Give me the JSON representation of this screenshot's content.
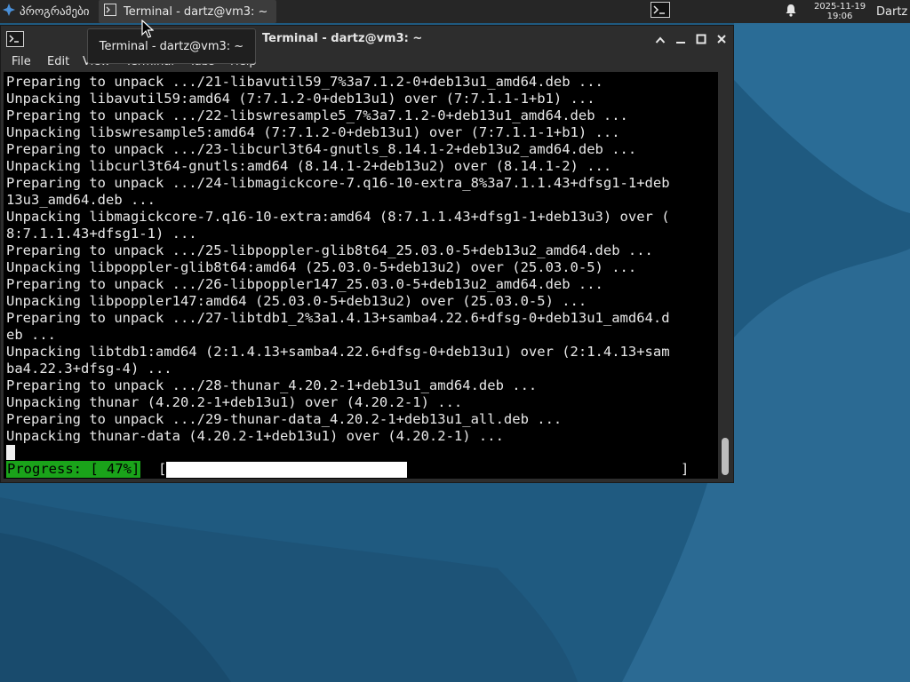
{
  "panel": {
    "app_menu_label": "პროგრამები",
    "task_title": "Terminal - dartz@vm3: ~",
    "clock_date": "2025-11-19",
    "clock_time": "19:06",
    "user_name": "Dartz"
  },
  "tooltip": {
    "text": "Terminal - dartz@vm3: ~"
  },
  "window": {
    "title": "Terminal - dartz@vm3: ~",
    "menu": [
      "File",
      "Edit",
      "View",
      "Terminal",
      "Tabs",
      "Help"
    ]
  },
  "terminal": {
    "lines": [
      "Preparing to unpack .../21-libavutil59_7%3a7.1.2-0+deb13u1_amd64.deb ...",
      "Unpacking libavutil59:amd64 (7:7.1.2-0+deb13u1) over (7:7.1.1-1+b1) ...",
      "Preparing to unpack .../22-libswresample5_7%3a7.1.2-0+deb13u1_amd64.deb ...",
      "Unpacking libswresample5:amd64 (7:7.1.2-0+deb13u1) over (7:7.1.1-1+b1) ...",
      "Preparing to unpack .../23-libcurl3t64-gnutls_8.14.1-2+deb13u2_amd64.deb ...",
      "Unpacking libcurl3t64-gnutls:amd64 (8.14.1-2+deb13u2) over (8.14.1-2) ...",
      "Preparing to unpack .../24-libmagickcore-7.q16-10-extra_8%3a7.1.1.43+dfsg1-1+deb",
      "13u3_amd64.deb ...",
      "Unpacking libmagickcore-7.q16-10-extra:amd64 (8:7.1.1.43+dfsg1-1+deb13u3) over (",
      "8:7.1.1.43+dfsg1-1) ...",
      "Preparing to unpack .../25-libpoppler-glib8t64_25.03.0-5+deb13u2_amd64.deb ...",
      "Unpacking libpoppler-glib8t64:amd64 (25.03.0-5+deb13u2) over (25.03.0-5) ...",
      "Preparing to unpack .../26-libpoppler147_25.03.0-5+deb13u2_amd64.deb ...",
      "Unpacking libpoppler147:amd64 (25.03.0-5+deb13u2) over (25.03.0-5) ...",
      "Preparing to unpack .../27-libtdb1_2%3a1.4.13+samba4.22.6+dfsg-0+deb13u1_amd64.d",
      "eb ...",
      "Unpacking libtdb1:amd64 (2:1.4.13+samba4.22.6+dfsg-0+deb13u1) over (2:1.4.13+sam",
      "ba4.22.3+dfsg-4) ...",
      "Preparing to unpack .../28-thunar_4.20.2-1+deb13u1_amd64.deb ...",
      "Unpacking thunar (4.20.2-1+deb13u1) over (4.20.2-1) ...",
      "Preparing to unpack .../29-thunar-data_4.20.2-1+deb13u1_all.deb ...",
      "Unpacking thunar-data (4.20.2-1+deb13u1) over (4.20.2-1) ..."
    ],
    "progress_label": "Progress: [ 47%]",
    "progress_open": "[",
    "progress_close": "]",
    "progress_fraction": 0.47
  },
  "colors": {
    "desktop": "#1f5a80",
    "panel": "#262626",
    "terminal_bg": "#000000",
    "progress_accent": "#1aa31a"
  },
  "icons": {
    "app_menu": "app-menu-icon",
    "task": "terminal-icon",
    "launcher": "terminal-launcher-icon",
    "notifications": "bell-icon",
    "window": "terminal-icon",
    "above": "chevron-up-icon",
    "minimize": "minimize-icon",
    "maximize": "maximize-icon",
    "close": "close-icon"
  }
}
